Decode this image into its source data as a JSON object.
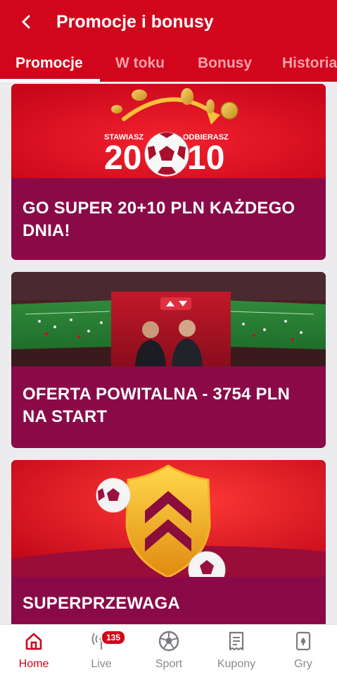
{
  "header": {
    "title": "Promocje i bonusy",
    "back_icon": "chevron-left-icon"
  },
  "tabs": [
    {
      "label": "Promocje",
      "active": true
    },
    {
      "label": "W toku",
      "active": false
    },
    {
      "label": "Bonusy",
      "active": false
    },
    {
      "label": "Historia",
      "active": false
    }
  ],
  "promotions": [
    {
      "title": "GO SUPER 20+10 PLN KAŻDEGO DNIA!",
      "banner": {
        "left_label": "STAWIASZ",
        "right_label": "ODBIERASZ",
        "left_number": "20",
        "right_number": "10"
      }
    },
    {
      "title": "OFERTA POWITALNA - 3754 PLN NA START",
      "banner": {
        "image": "football-stadium-hosts-image"
      }
    },
    {
      "title": "SUPERPRZEWAGA",
      "banner": {
        "image": "golden-shield-chevrons-image"
      }
    }
  ],
  "bottom_nav": [
    {
      "label": "Home",
      "icon": "home-icon",
      "active": true
    },
    {
      "label": "Live",
      "icon": "live-broadcast-icon",
      "active": false,
      "badge": "135"
    },
    {
      "label": "Sport",
      "icon": "soccer-ball-icon",
      "active": false
    },
    {
      "label": "Kupony",
      "icon": "receipt-icon",
      "active": false
    },
    {
      "label": "Gry",
      "icon": "playing-card-icon",
      "active": false
    }
  ],
  "colors": {
    "brand_red": "#d1061c",
    "card_maroon": "#8a0a48",
    "background": "#ececef",
    "inactive_tab": "#f7a0aa",
    "nav_inactive": "#8a8a8f"
  }
}
